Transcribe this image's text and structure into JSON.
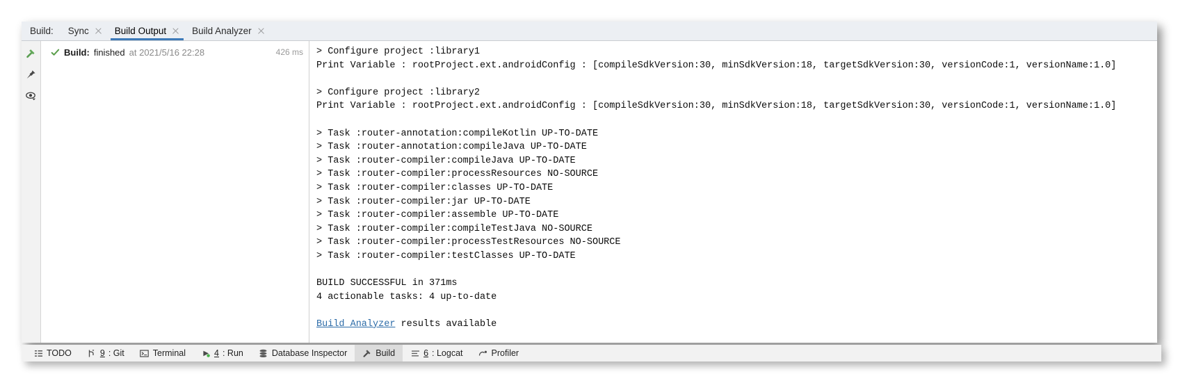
{
  "tabbar": {
    "label": "Build:",
    "tabs": [
      {
        "title": "Sync",
        "active": false,
        "closable": true
      },
      {
        "title": "Build Output",
        "active": true,
        "closable": true
      },
      {
        "title": "Build Analyzer",
        "active": false,
        "closable": true
      }
    ]
  },
  "rail": {
    "icons": [
      {
        "name": "build-hammer-icon",
        "title": "Build"
      },
      {
        "name": "pin-icon",
        "title": "Pin"
      },
      {
        "name": "eye-icon",
        "title": "Show"
      }
    ]
  },
  "tree": {
    "row": {
      "status_icon": "green-check-icon",
      "title": "Build:",
      "state": "finished",
      "at": "at 2021/5/16 22:28",
      "duration": "426 ms"
    }
  },
  "console": {
    "lines": [
      {
        "text": "> Configure project :library1"
      },
      {
        "text": "Print Variable : rootProject.ext.androidConfig : [compileSdkVersion:30, minSdkVersion:18, targetSdkVersion:30, versionCode:1, versionName:1.0]"
      },
      {
        "text": ""
      },
      {
        "text": "> Configure project :library2"
      },
      {
        "text": "Print Variable : rootProject.ext.androidConfig : [compileSdkVersion:30, minSdkVersion:18, targetSdkVersion:30, versionCode:1, versionName:1.0]"
      },
      {
        "text": ""
      },
      {
        "text": "> Task :router-annotation:compileKotlin UP-TO-DATE"
      },
      {
        "text": "> Task :router-annotation:compileJava UP-TO-DATE"
      },
      {
        "text": "> Task :router-compiler:compileJava UP-TO-DATE"
      },
      {
        "text": "> Task :router-compiler:processResources NO-SOURCE"
      },
      {
        "text": "> Task :router-compiler:classes UP-TO-DATE"
      },
      {
        "text": "> Task :router-compiler:jar UP-TO-DATE"
      },
      {
        "text": "> Task :router-compiler:assemble UP-TO-DATE"
      },
      {
        "text": "> Task :router-compiler:compileTestJava NO-SOURCE"
      },
      {
        "text": "> Task :router-compiler:processTestResources NO-SOURCE"
      },
      {
        "text": "> Task :router-compiler:testClasses UP-TO-DATE"
      },
      {
        "text": ""
      },
      {
        "text": "BUILD SUCCESSFUL in 371ms"
      },
      {
        "text": "4 actionable tasks: 4 up-to-date"
      },
      {
        "text": ""
      }
    ],
    "link_line": {
      "link_text": "Build Analyzer",
      "rest_text": " results available"
    }
  },
  "statusbar": {
    "items": [
      {
        "icon": "todo-list-icon",
        "mnemonic": "",
        "label": "TODO",
        "active": false
      },
      {
        "icon": "git-branch-icon",
        "mnemonic": "9",
        "label": ": Git",
        "active": false
      },
      {
        "icon": "terminal-icon",
        "mnemonic": "",
        "label": "Terminal",
        "active": false
      },
      {
        "icon": "run-play-icon",
        "mnemonic": "4",
        "label": ": Run",
        "active": false
      },
      {
        "icon": "database-icon",
        "mnemonic": "",
        "label": "Database Inspector",
        "active": false
      },
      {
        "icon": "build-hammer-icon",
        "mnemonic": "",
        "label": "Build",
        "active": true
      },
      {
        "icon": "logcat-icon",
        "mnemonic": "6",
        "label": ": Logcat",
        "active": false
      },
      {
        "icon": "profiler-icon",
        "mnemonic": "",
        "label": "Profiler",
        "active": false
      }
    ]
  },
  "colors": {
    "accent_tab_underline": "#3d7ab8",
    "link": "#2d6ca8",
    "success_green": "#5a9e4b",
    "window_bg": "#f2f2f2"
  }
}
